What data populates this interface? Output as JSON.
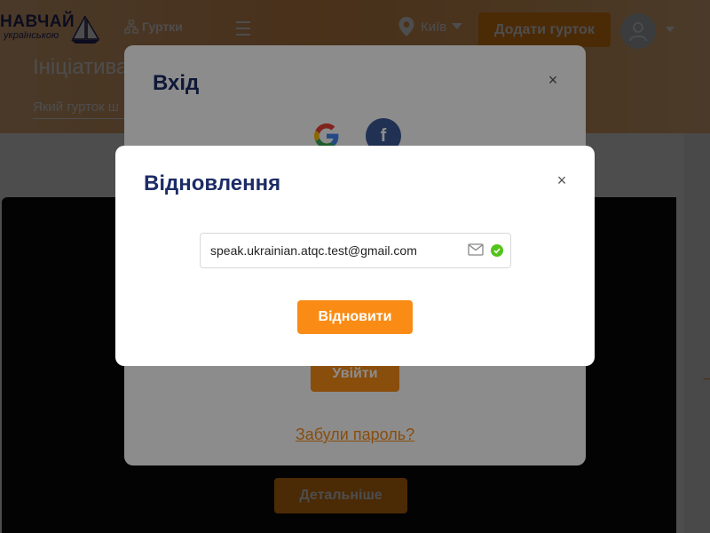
{
  "header": {
    "logo_main": "НАВЧАЙ",
    "logo_sub": "українською",
    "clubs_label": "Гуртки",
    "city": "Київ",
    "add_club_label": "Додати гурток"
  },
  "hero": {
    "title": "Ініціатива",
    "search_placeholder": "Який гурток ш"
  },
  "page": {
    "details_label": "Детальніше"
  },
  "login_modal": {
    "title": "Вхід",
    "close_glyph": "×",
    "facebook_glyph": "f",
    "login_label": "Увійти",
    "forgot_label": "Забули пароль?"
  },
  "restore_modal": {
    "title": "Відновлення",
    "close_glyph": "×",
    "email_value": "speak.ukrainian.atqc.test@gmail.com",
    "restore_label": "Відновити"
  },
  "colors": {
    "accent": "#fa8c16",
    "title": "#1c2c66",
    "success": "#52c41a",
    "facebook": "#3b5998"
  }
}
